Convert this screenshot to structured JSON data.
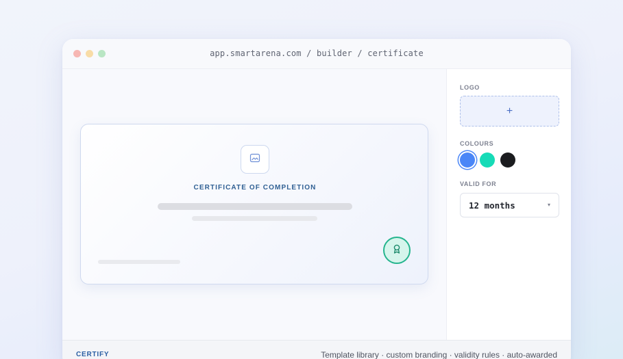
{
  "window": {
    "url": "app.smartarena.com / builder / certificate"
  },
  "certificate": {
    "title": "CERTIFICATE OF COMPLETION",
    "logo_icon": "image-icon",
    "badge_icon": "award-ribbon-icon"
  },
  "panel": {
    "logo_label": "LOGO",
    "logo_add": "+",
    "colours_label": "COLOURS",
    "colours": [
      "#4a86f7",
      "#16dbb7",
      "#1b1c1f"
    ],
    "selected_colour": "#4a86f7",
    "valid_label": "VALID FOR",
    "valid_value": "12 months",
    "valid_caret": "▾"
  },
  "footer": {
    "brand": "CERTIFY",
    "features": "Template library · custom branding · validity rules · auto-awarded"
  }
}
